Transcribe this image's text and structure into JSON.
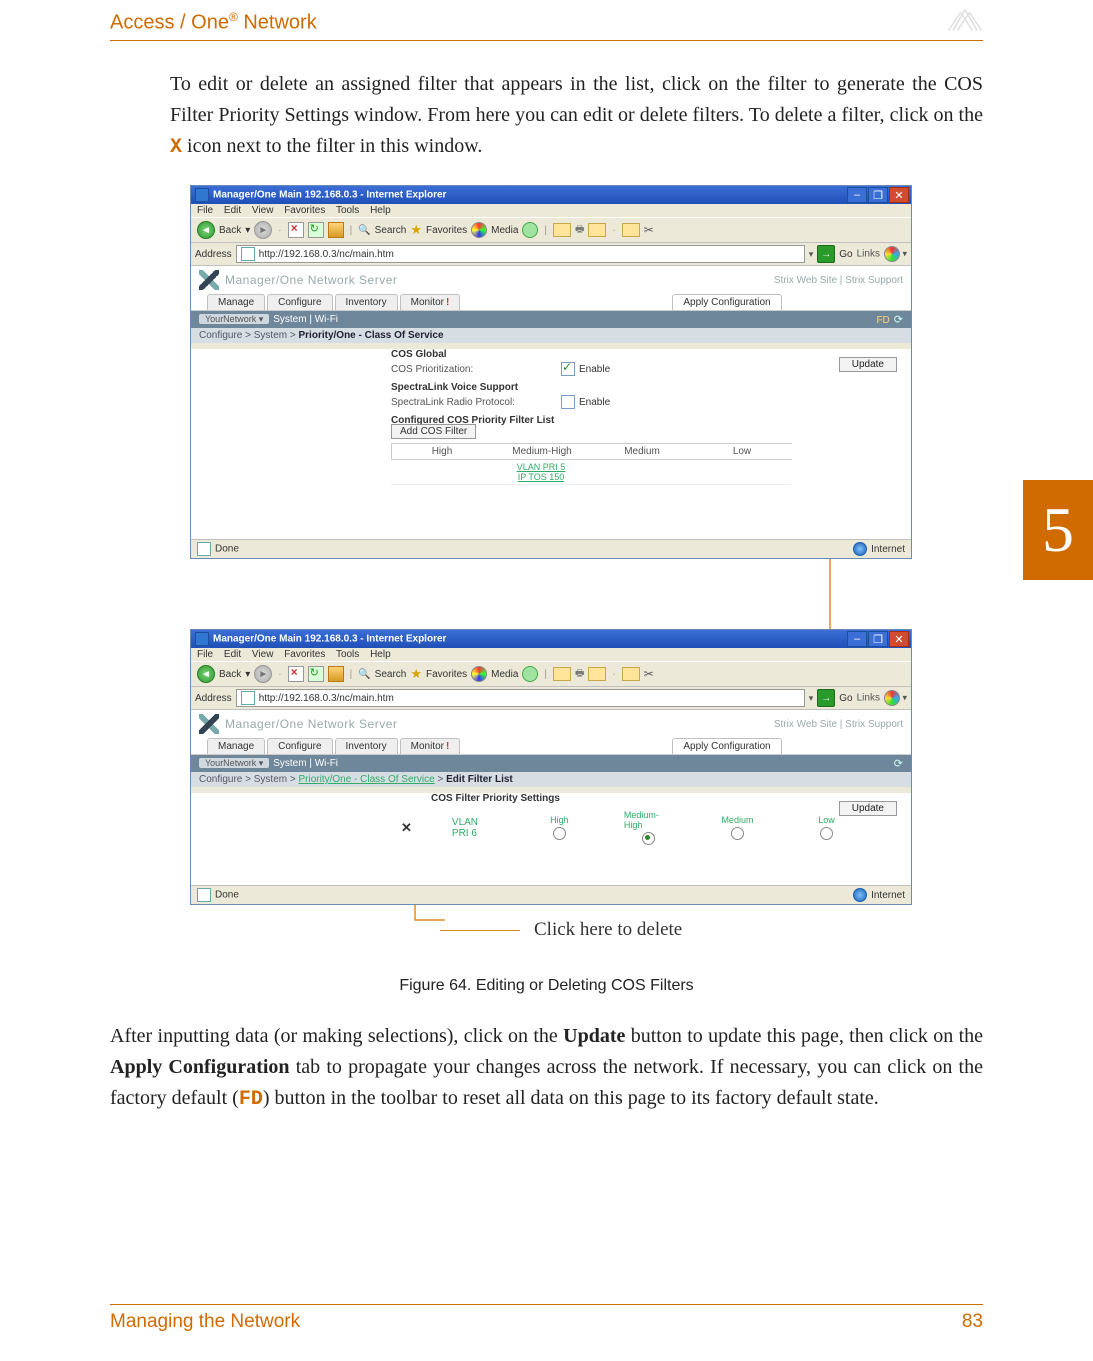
{
  "header": {
    "product": "Access / One",
    "reg": "®",
    "suffix": "Network"
  },
  "intro": {
    "p1_a": "To edit or delete an assigned filter that appears in the list, click on the filter to generate the COS Filter Priority Settings window. From here you can edit or delete filters. To delete a filter, click on the ",
    "x": "X",
    "p1_b": " icon next to the filter in this window."
  },
  "ie": {
    "title": "Manager/One Main 192.168.0.3 - Internet Explorer",
    "menu": {
      "file": "File",
      "edit": "Edit",
      "view": "View",
      "favorites": "Favorites",
      "tools": "Tools",
      "help": "Help"
    },
    "back": "Back",
    "searchLbl": "Search",
    "favLbl": "Favorites",
    "mediaLbl": "Media",
    "addressLbl": "Address",
    "url": "http://192.168.0.3/nc/main.htm",
    "goLbl": "Go",
    "linksLbl": "Links",
    "done": "Done",
    "internet": "Internet"
  },
  "mone": {
    "server": "Manager/One Network Server",
    "toplinks": "Strix Web Site   |   Strix Support",
    "tabs": {
      "manage": "Manage",
      "configure": "Configure",
      "inventory": "Inventory",
      "monitor": "Monitor",
      "apply": "Apply Configuration"
    },
    "subbar": {
      "left": "System   |   Wi-Fi",
      "fd": "FD"
    },
    "crumb1_a": "Configure > System > ",
    "crumb1_b": "Priority/One - Class Of Service",
    "crumb2_a": "Configure > System > ",
    "crumb2_link": "Priority/One - Class Of Service",
    "crumb2_b": " > ",
    "crumb2_c": "Edit Filter List",
    "update": "Update",
    "panel1": {
      "h1": "COS Global",
      "row1": "COS Prioritization:",
      "row1v": "Enable",
      "h2": "SpectraLink Voice Support",
      "row2": "SpectraLink Radio Protocol:",
      "row2v": "Enable",
      "h3": "Configured COS Priority Filter List",
      "addBtn": "Add COS Filter",
      "cols": {
        "c1": "High",
        "c2": "Medium-High",
        "c3": "Medium",
        "c4": "Low"
      },
      "cell": "VLAN PRI 5\nIP TOS 150"
    },
    "panel2": {
      "h": "COS Filter Priority Settings",
      "name": "VLAN PRI 6",
      "cols": {
        "c1": "High",
        "c2": "Medium-High",
        "c3": "Medium",
        "c4": "Low"
      }
    }
  },
  "annotation": "Click here to delete",
  "figureLabel": "Figure 64. Editing or Deleting COS Filters",
  "outro": {
    "a": "After inputting data (or making selections), click on the ",
    "b": "Update",
    "c": " button to update this page, then click on the ",
    "d": "Apply Configuration",
    "e": " tab to propagate your changes across the network. If necessary, you can click on the factory default (",
    "fd": "FD",
    "f": ") button in the toolbar to reset all data on this page to its factory default state."
  },
  "chapterTab": "5",
  "footer": {
    "left": "Managing the Network",
    "right": "83"
  }
}
